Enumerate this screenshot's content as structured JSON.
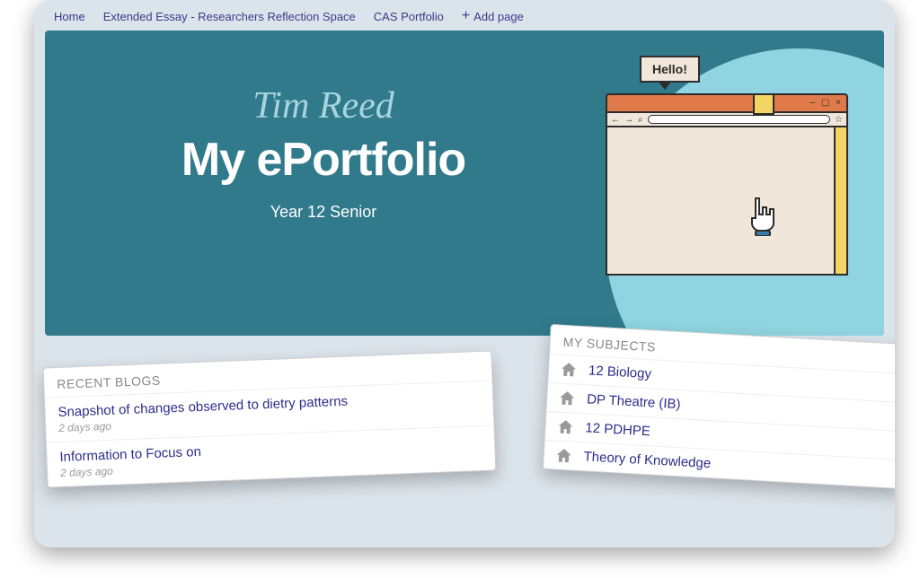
{
  "nav": {
    "home": "Home",
    "ee": "Extended Essay - Researchers Reflection Space",
    "cas": "CAS Portfolio",
    "add": "Add page"
  },
  "hero": {
    "name": "Tim Reed",
    "title": "My ePortfolio",
    "subtitle": "Year 12 Senior",
    "speech": "Hello!"
  },
  "blogs": {
    "header": "RECENT BLOGS",
    "items": [
      {
        "title": "Snapshot of changes observed to dietry patterns",
        "meta": "2 days ago"
      },
      {
        "title": "Information to Focus on",
        "meta": "2 days ago"
      }
    ]
  },
  "subjects": {
    "header": "MY SUBJECTS",
    "items": [
      {
        "name": "12 Biology"
      },
      {
        "name": "DP Theatre (IB)"
      },
      {
        "name": "12 PDHPE"
      },
      {
        "name": "Theory of Knowledge"
      }
    ]
  }
}
